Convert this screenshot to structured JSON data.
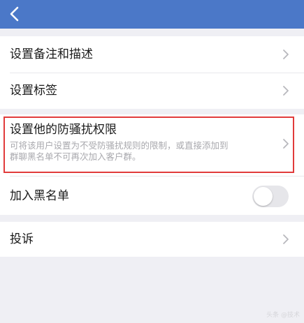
{
  "header": {
    "back_icon": "chevron-left-icon",
    "bar_color": "#4b78c8"
  },
  "rows": {
    "remark": {
      "label": "设置备注和描述"
    },
    "tags": {
      "label": "设置标签"
    },
    "anti_harass": {
      "label": "设置他的防骚扰权限",
      "description_line1": "可将该用户设置为不受防骚扰规则的限制，或直接添加到",
      "description_line2": "群聊黑名单不可再次加入客户群。"
    },
    "blacklist": {
      "label": "加入黑名单",
      "toggle_on": false
    },
    "report": {
      "label": "投诉"
    }
  },
  "highlight_color": "#e13b3b",
  "watermark": "头条 @技术"
}
